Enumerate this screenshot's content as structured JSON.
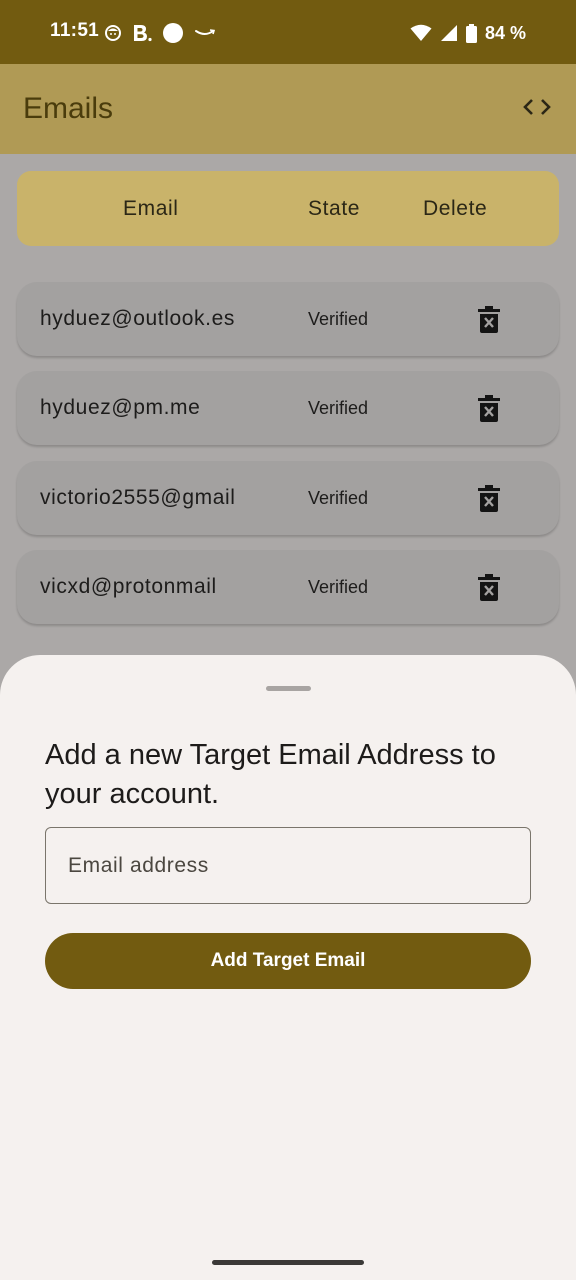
{
  "status_bar": {
    "time": "11:51",
    "left_icons": [
      "face-icon",
      "booking-b-icon",
      "circle-dot-icon",
      "amazon-smile-icon"
    ],
    "right_icons": [
      "wifi-icon",
      "cell-signal-icon",
      "battery-icon"
    ],
    "battery": "84 %"
  },
  "app_bar": {
    "title": "Emails",
    "action_icon": "code-icon"
  },
  "table": {
    "headers": {
      "email": "Email",
      "state": "State",
      "delete": "Delete"
    },
    "rows": [
      {
        "email": "hyduez@outlook.es",
        "state": "Verified"
      },
      {
        "email": "hyduez@pm.me",
        "state": "Verified"
      },
      {
        "email": "victorio2555@gmail",
        "state": "Verified"
      },
      {
        "email": "vicxd@protonmail",
        "state": "Verified"
      }
    ]
  },
  "sheet": {
    "title": "Add a new Target Email Address to your account.",
    "input_placeholder": "Email address",
    "input_value": "",
    "button_label": "Add Target Email"
  },
  "colors": {
    "status_bar": "#725b10",
    "app_bar": "#b09a55",
    "header_row": "#c9b36a",
    "primary_button": "#725b10",
    "sheet_background": "#f5f1ef"
  }
}
